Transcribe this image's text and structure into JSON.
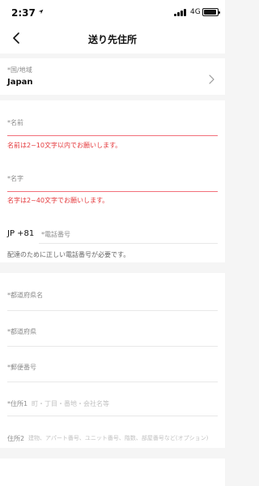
{
  "status_bar": {
    "time": "2:37",
    "network": "4G"
  },
  "nav": {
    "title": "送り先住所"
  },
  "country": {
    "label": "*国/地域",
    "value": "Japan"
  },
  "first_name": {
    "label": "*名前",
    "error": "名前は2~10文字以内でお願いします。"
  },
  "last_name": {
    "label": "*名字",
    "error": "名字は2~40文字でお願いします。"
  },
  "phone": {
    "prefix": "JP +81",
    "label": "*電話番号",
    "note": "配達のために正しい電話番号が必要です。"
  },
  "prefecture_name": {
    "label": "*都道府県名"
  },
  "prefecture": {
    "label": "*都道府県"
  },
  "postal_code": {
    "label": "*郵便番号"
  },
  "address1": {
    "label": "*住所1",
    "placeholder": "町・丁目・番地・会社名等"
  },
  "address2": {
    "label": "住所2",
    "placeholder": "建物、アパート番号、ユニット番号、階数、部屋番号など(オプション)"
  },
  "icons": {
    "back": "chevron-left-icon",
    "select": "chevron-right-icon",
    "location": "location-arrow-icon",
    "signal": "signal-icon",
    "battery": "battery-icon"
  }
}
